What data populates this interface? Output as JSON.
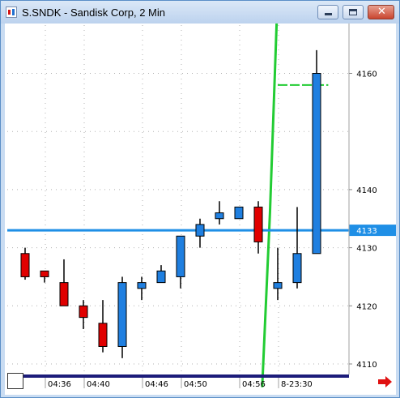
{
  "window": {
    "title": "S.SNDK - Sandisk Corp, 2 Min",
    "buttons": {
      "minimize": "minimize",
      "maximize": "maximize",
      "close": "close"
    }
  },
  "chart_data": {
    "type": "candlestick",
    "title": "S.SNDK - Sandisk Corp, 2 Min",
    "ylim": [
      4106,
      4180
    ],
    "y_ticks": [
      4110,
      4120,
      4130,
      4140,
      4160
    ],
    "y_tick_labels": [
      "4110",
      "4120",
      "4130",
      "4140",
      "4160"
    ],
    "x_tick_labels": [
      "04:36",
      "04:40",
      "04:46",
      "04:50",
      "04:56",
      "8-23:30"
    ],
    "grid": true,
    "last_price": 4133,
    "last_price_label": "4133",
    "horizontal_line": 4133,
    "colors": {
      "up": "#1f7fe0",
      "down": "#e00000",
      "price_line": "#1f8fe6",
      "indicator": "#22cc33"
    },
    "candles": [
      {
        "open": 4129,
        "high": 4130,
        "low": 4124.5,
        "close": 4125
      },
      {
        "open": 4126,
        "high": 4126,
        "low": 4124,
        "close": 4125
      },
      {
        "open": 4124,
        "high": 4128,
        "low": 4120,
        "close": 4120
      },
      {
        "open": 4120,
        "high": 4121,
        "low": 4116,
        "close": 4118
      },
      {
        "open": 4117,
        "high": 4121,
        "low": 4112,
        "close": 4113
      },
      {
        "open": 4113,
        "high": 4125,
        "low": 4111,
        "close": 4124
      },
      {
        "open": 4123,
        "high": 4125,
        "low": 4121,
        "close": 4124
      },
      {
        "open": 4124,
        "high": 4127,
        "low": 4124,
        "close": 4126
      },
      {
        "open": 4125,
        "high": 4132,
        "low": 4123,
        "close": 4132
      },
      {
        "open": 4132,
        "high": 4135,
        "low": 4130,
        "close": 4134
      },
      {
        "open": 4135,
        "high": 4138,
        "low": 4134,
        "close": 4136
      },
      {
        "open": 4135,
        "high": 4137,
        "low": 4135,
        "close": 4137
      },
      {
        "open": 4137,
        "high": 4138,
        "low": 4129,
        "close": 4131
      },
      {
        "open": 4123,
        "high": 4130,
        "low": 4121,
        "close": 4124
      },
      {
        "open": 4124,
        "high": 4137,
        "low": 4123,
        "close": 4129
      },
      {
        "open": 4129,
        "high": 4164,
        "low": 4129,
        "close": 4160
      }
    ],
    "indicator_line": [
      {
        "x": 12.2,
        "y": 4106
      },
      {
        "x": 12.6,
        "y": 4136
      },
      {
        "x": 13.0,
        "y": 4174
      },
      {
        "x": 15.0,
        "y": 4174
      }
    ],
    "indicator_dash": {
      "x1": 13.0,
      "x2": 15.6,
      "y": 4158
    }
  }
}
